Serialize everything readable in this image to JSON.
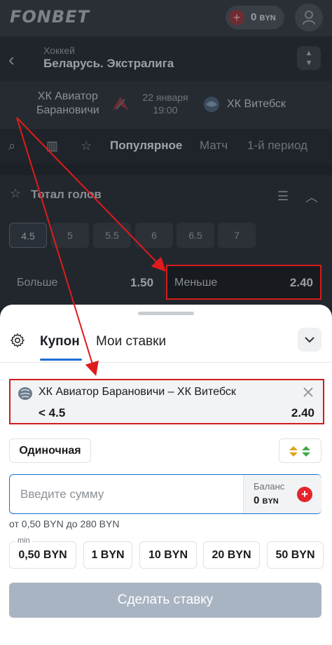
{
  "app": {
    "logo": "FONBET",
    "balance": "0",
    "currency": "BYN"
  },
  "nav": {
    "sport": "Хоккей",
    "league": "Беларусь. Экстралига"
  },
  "match": {
    "team1_line1": "ХК Авиатор",
    "team1_line2": "Барановичи",
    "date": "22 января",
    "time": "19:00",
    "team2": "ХК Витебск"
  },
  "tabs": [
    "Популярное",
    "Матч",
    "1-й период"
  ],
  "market": {
    "title": "Тотал голов",
    "lines": [
      "4.5",
      "5",
      "5.5",
      "6",
      "6.5",
      "7"
    ],
    "selected_line": "4.5",
    "over_label": "Больше",
    "over_odd": "1.50",
    "under_label": "Меньше",
    "under_odd": "2.40"
  },
  "coupon": {
    "tab_coupon": "Купон",
    "tab_my_bets": "Мои ставки",
    "event": "ХК Авиатор Барановичи – ХК Витебск",
    "outcome": "< 4.5",
    "coef": "2.40",
    "bet_type": "Одиночная",
    "amount_placeholder": "Введите сумму",
    "balance_label": "Баланс",
    "balance_value": "0",
    "balance_currency": "BYN",
    "range_text": "от 0,50 BYN до 280 BYN",
    "min_label": "min",
    "quick_amounts": [
      "0,50 BYN",
      "1 BYN",
      "10 BYN",
      "20 BYN",
      "50 BYN"
    ],
    "submit": "Сделать ставку"
  },
  "colors": {
    "accent": "#1d6fd1",
    "highlight": "#d31c1c",
    "submit_disabled": "#a9b4c2",
    "brand_red": "#e3262c"
  }
}
